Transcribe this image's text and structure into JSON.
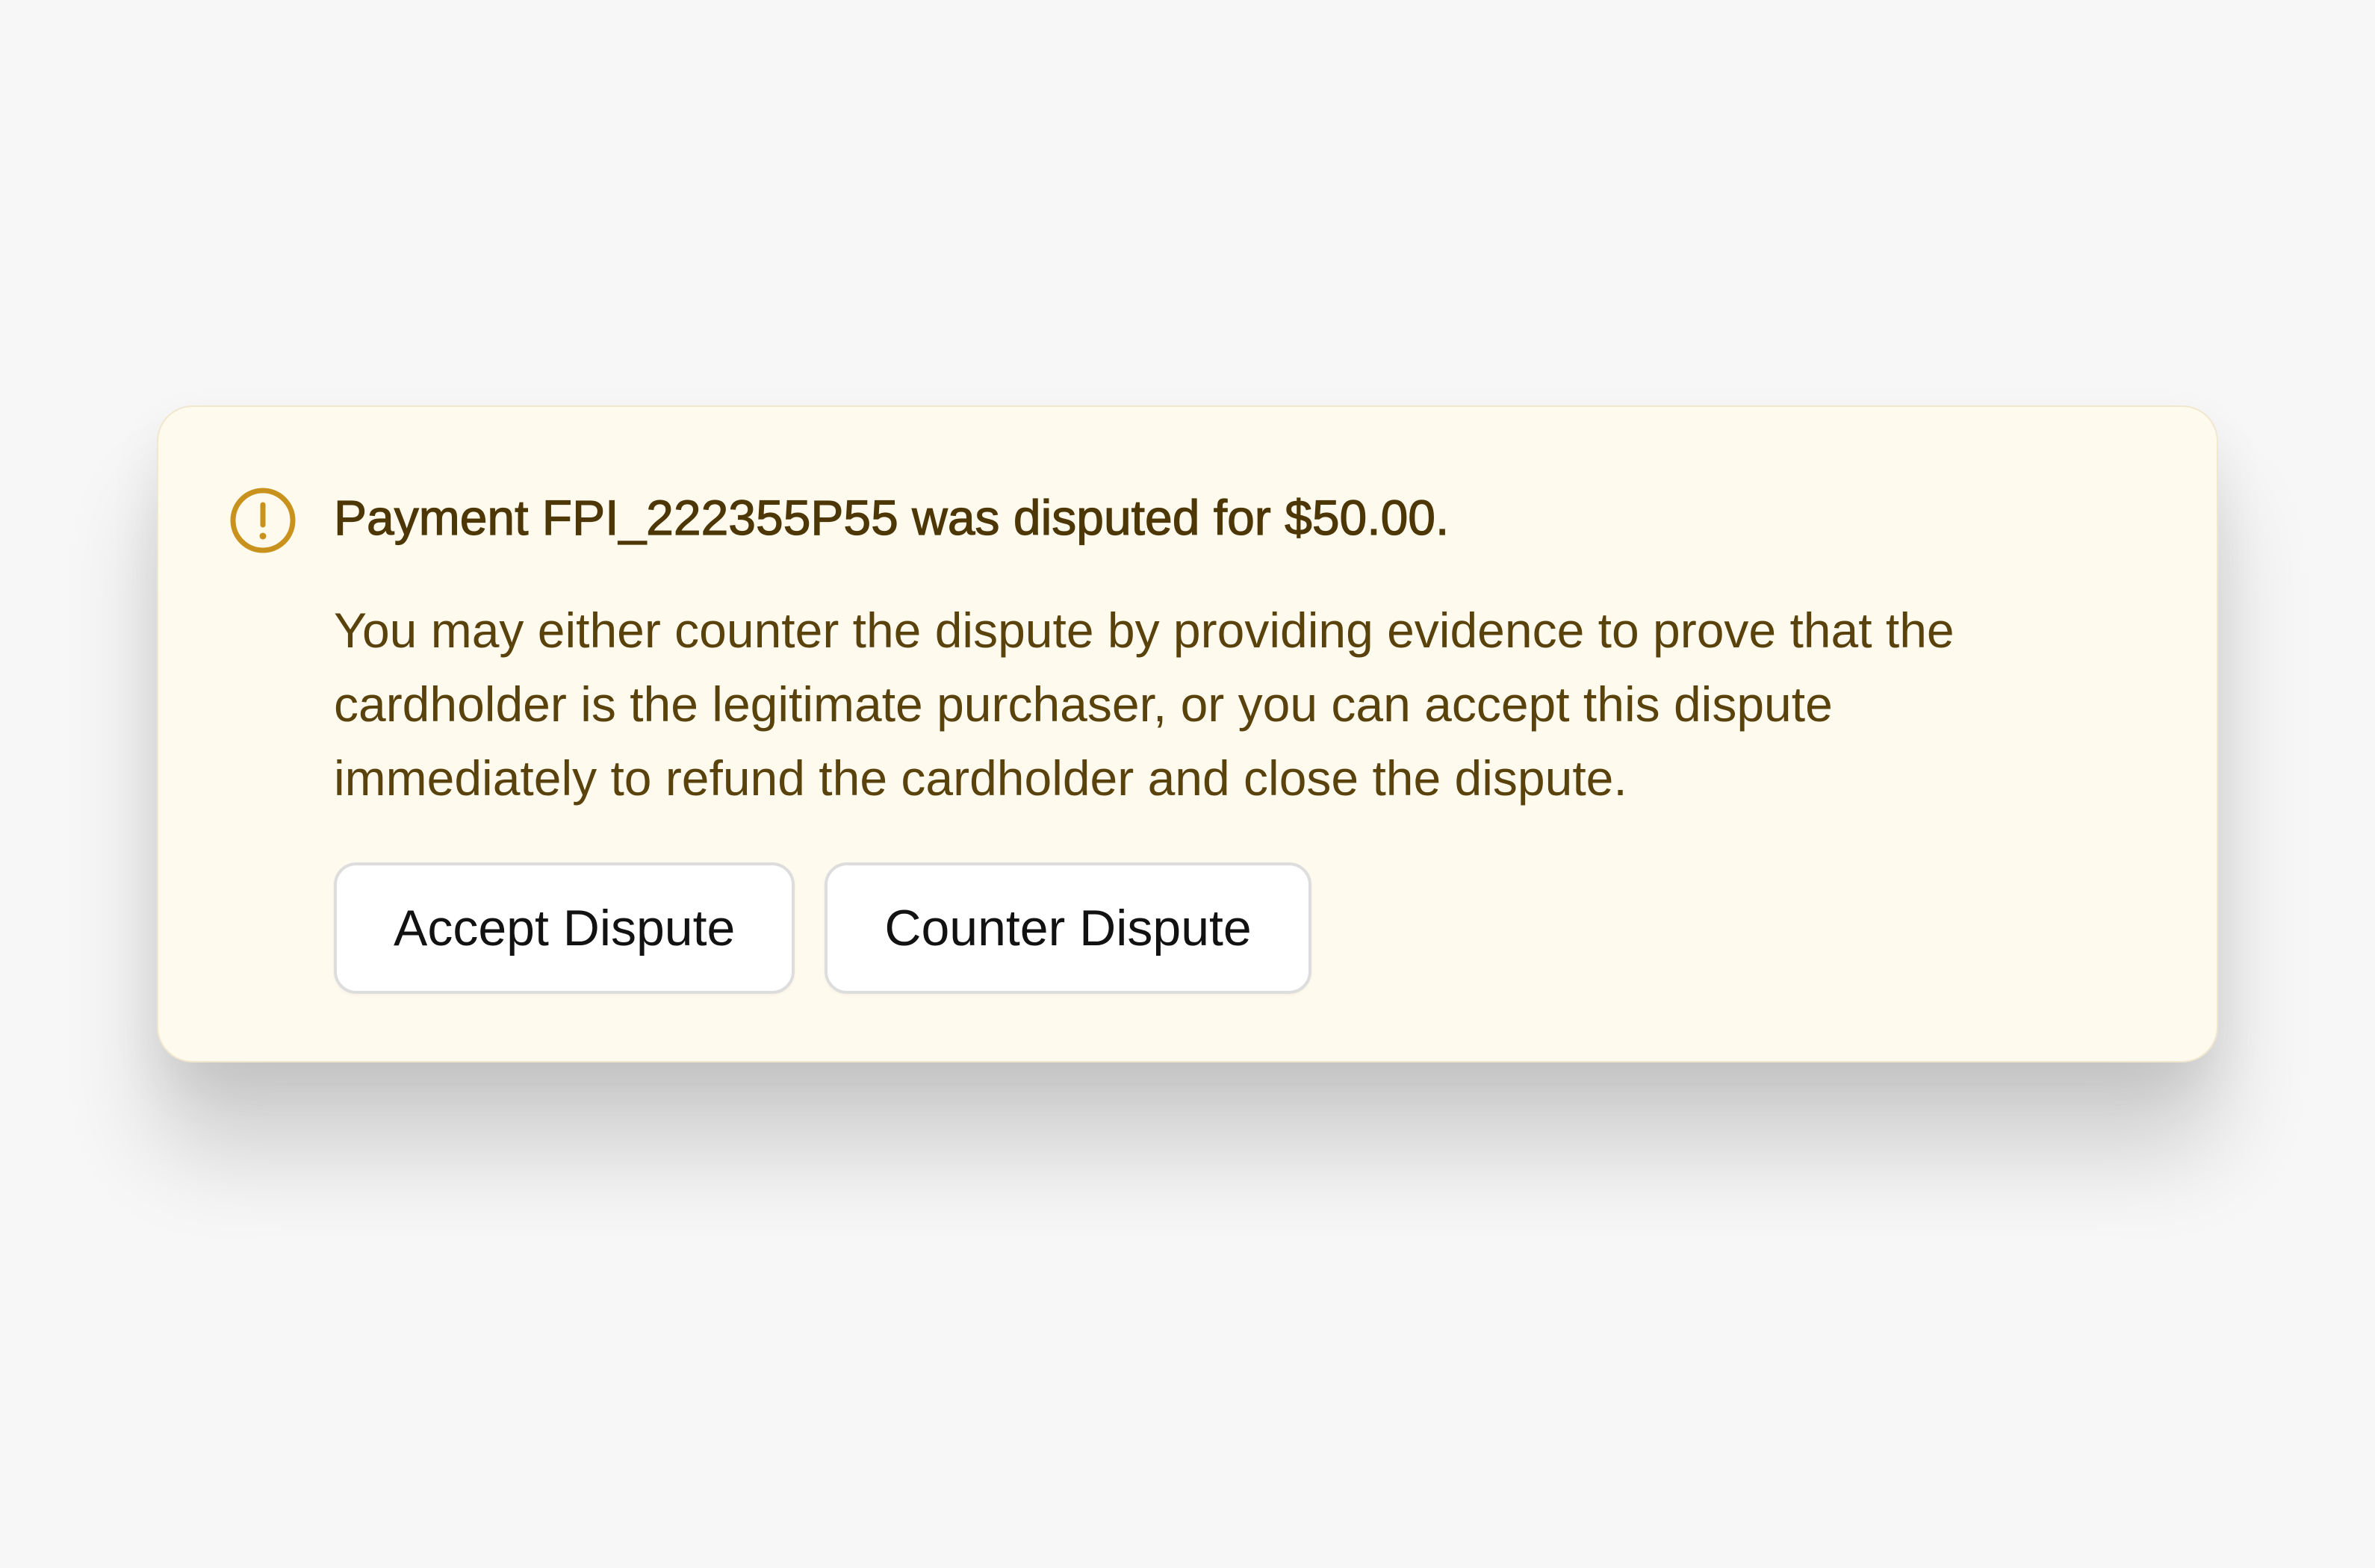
{
  "alert": {
    "icon": "exclamation-circle-icon",
    "title": "Payment FPI_222355P55 was disputed for $50.00.",
    "message": "You may either counter the dispute by providing evidence to prove that the cardholder is the legitimate purchaser, or you can accept this dispute immediately to refund the cardholder and close the dispute.",
    "actions": {
      "accept_label": "Accept Dispute",
      "counter_label": "Counter Dispute"
    }
  },
  "colors": {
    "page_background": "#f7f7f7",
    "card_background": "#fffaee",
    "icon_accent": "#c9921c",
    "title_text": "#4d3707",
    "body_text": "#5a420d",
    "button_background": "#ffffff",
    "button_border": "#dddddd",
    "button_text": "#121212"
  }
}
